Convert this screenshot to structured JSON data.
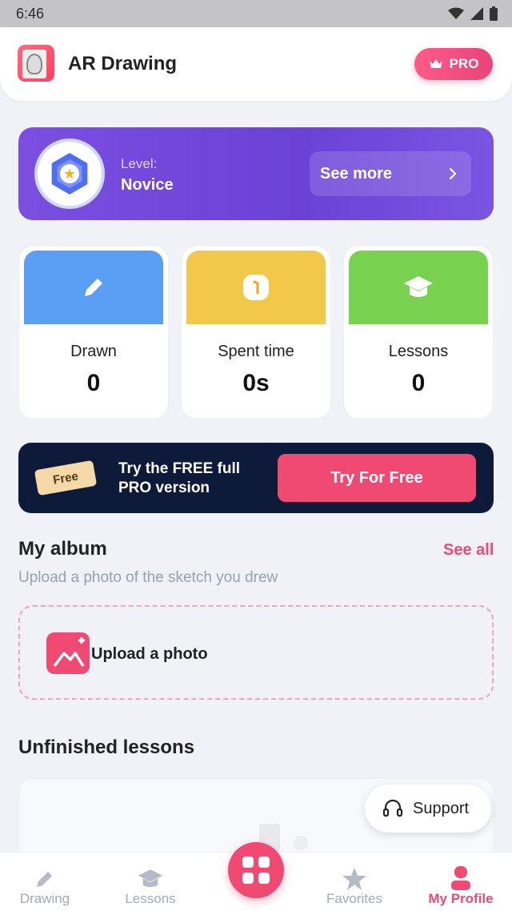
{
  "status_bar": {
    "time": "6:46"
  },
  "header": {
    "title": "AR Drawing",
    "pro_label": "PRO"
  },
  "level": {
    "label": "Level:",
    "value": "Novice",
    "see_more": "See more"
  },
  "stats": [
    {
      "label": "Drawn",
      "value": "0",
      "color": "#5b9ff5"
    },
    {
      "label": "Spent time",
      "value": "0s",
      "color": "#f2c84a"
    },
    {
      "label": "Lessons",
      "value": "0",
      "color": "#78d250"
    }
  ],
  "promo": {
    "ticket": "Free",
    "text": "Try the FREE full PRO version",
    "button": "Try For Free"
  },
  "album": {
    "title": "My album",
    "see_all": "See all",
    "subtitle": "Upload a photo of the sketch you drew",
    "upload_label": "Upload a photo"
  },
  "lessons": {
    "title": "Unfinished lessons"
  },
  "support": {
    "label": "Support"
  },
  "nav": [
    {
      "label": "Drawing",
      "icon": "pencil-icon"
    },
    {
      "label": "Lessons",
      "icon": "graduation-cap-icon"
    },
    {
      "label": "Favorites",
      "icon": "star-icon"
    },
    {
      "label": "My Profile",
      "icon": "person-icon"
    }
  ]
}
